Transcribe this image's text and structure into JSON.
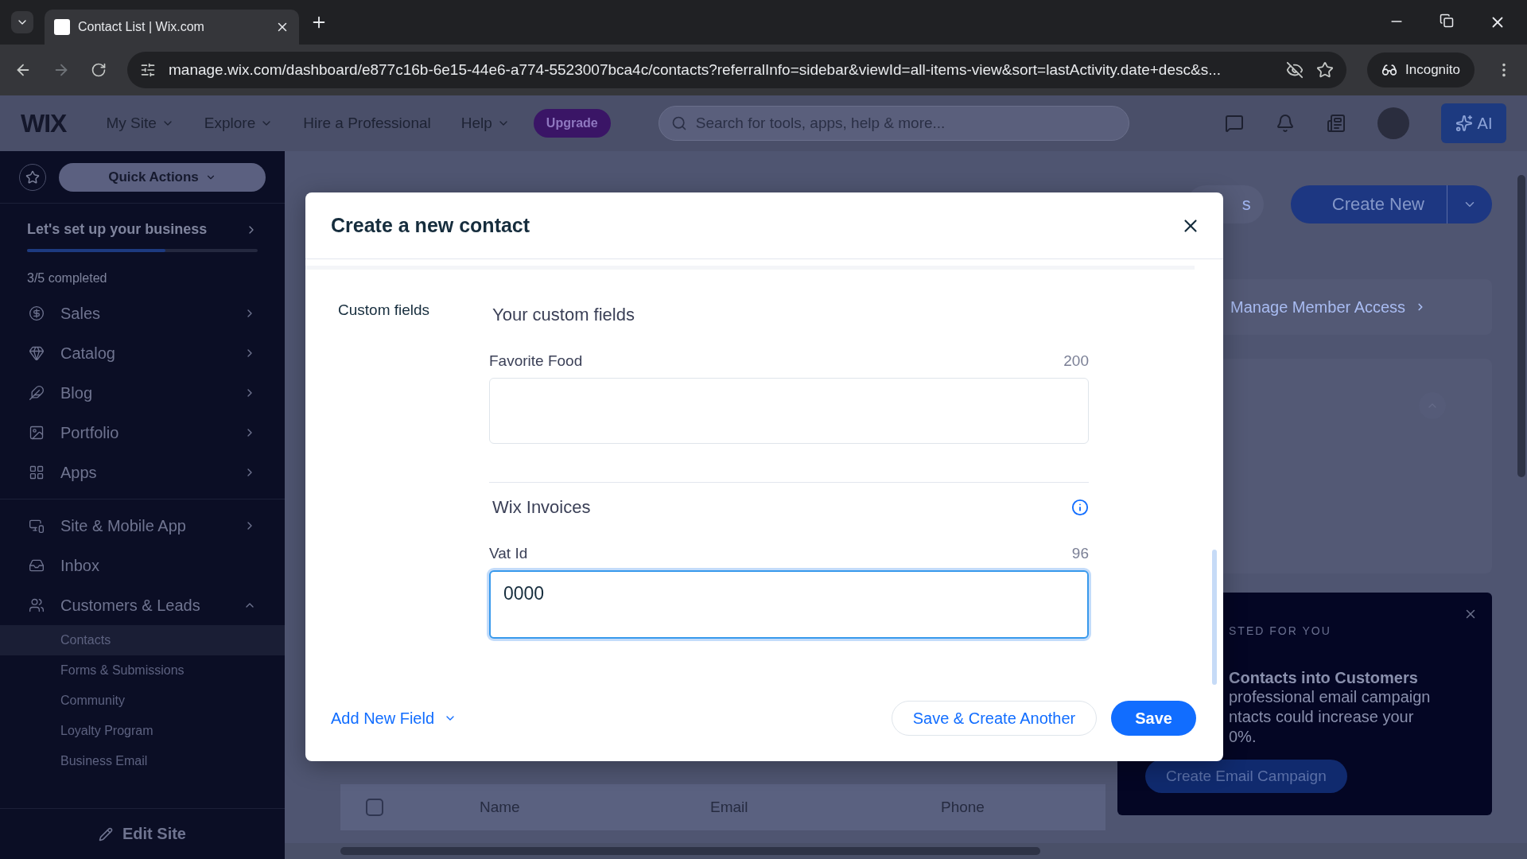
{
  "browser": {
    "tab_title": "Contact List | Wix.com",
    "url": "manage.wix.com/dashboard/e877c16b-6e15-44e6-a774-5523007bca4c/contacts?referralInfo=sidebar&viewId=all-items-view&sort=lastActivity.date+desc&s...",
    "incognito_label": "Incognito"
  },
  "topbar": {
    "logo": "WIX",
    "menu": [
      {
        "label": "My Site",
        "dropdown": true
      },
      {
        "label": "Explore",
        "dropdown": true
      },
      {
        "label": "Hire a Professional",
        "dropdown": false
      },
      {
        "label": "Help",
        "dropdown": true
      }
    ],
    "upgrade": "Upgrade",
    "search": {
      "placeholder": "Search for tools, apps, help & more..."
    },
    "ai_label": "AI"
  },
  "sidebar": {
    "quick_actions": "Quick Actions",
    "setup": {
      "title": "Let's set up your business",
      "level": 0.6,
      "progress": "3/5 completed"
    },
    "groups": [
      [
        {
          "label": "Sales",
          "kind": "sales",
          "expanded": false
        },
        {
          "label": "Catalog",
          "kind": "catalog",
          "expanded": false
        },
        {
          "label": "Blog",
          "kind": "blog",
          "expanded": false
        },
        {
          "label": "Portfolio",
          "kind": "portfolio",
          "expanded": false
        },
        {
          "label": "Apps",
          "kind": "apps",
          "expanded": false
        }
      ],
      [
        {
          "label": "Site & Mobile App",
          "kind": "site",
          "expanded": false
        },
        {
          "label": "Inbox",
          "kind": "inbox"
        },
        {
          "label": "Customers & Leads",
          "kind": "customers",
          "expanded": true,
          "children": [
            {
              "label": "Contacts",
              "selected": true
            },
            {
              "label": "Forms & Submissions",
              "selected": false
            },
            {
              "label": "Community",
              "selected": false
            },
            {
              "label": "Loyalty Program",
              "selected": false
            },
            {
              "label": "Business Email",
              "selected": false
            }
          ]
        }
      ]
    ],
    "edit_site": "Edit Site"
  },
  "page": {
    "partial_button": "s",
    "create_new": "Create New",
    "member_access": "Manage Member Access",
    "table": {
      "select_all_checked": false,
      "columns": [
        "Name",
        "Email",
        "Phone"
      ]
    },
    "promo": {
      "eyebrow": "STED FOR YOU",
      "title": "Contacts into Customers",
      "body_lines": [
        "professional email campaign",
        "ntacts could increase your",
        "0%."
      ],
      "button": "Create Email Campaign"
    }
  },
  "modal": {
    "title": "Create a new contact",
    "section_label": "Custom fields",
    "groups": [
      {
        "heading": "Your custom fields",
        "info": false,
        "fields": [
          {
            "label": "Favorite Food",
            "limit": "200",
            "focused": false
          }
        ]
      },
      {
        "heading": "Wix Invoices",
        "info": true,
        "fields": [
          {
            "label": "Vat Id",
            "limit": "96",
            "value": "0000",
            "focused": true
          }
        ]
      }
    ],
    "add_field": "Add New Field",
    "secondary_button": "Save & Create Another",
    "primary_button": "Save"
  }
}
